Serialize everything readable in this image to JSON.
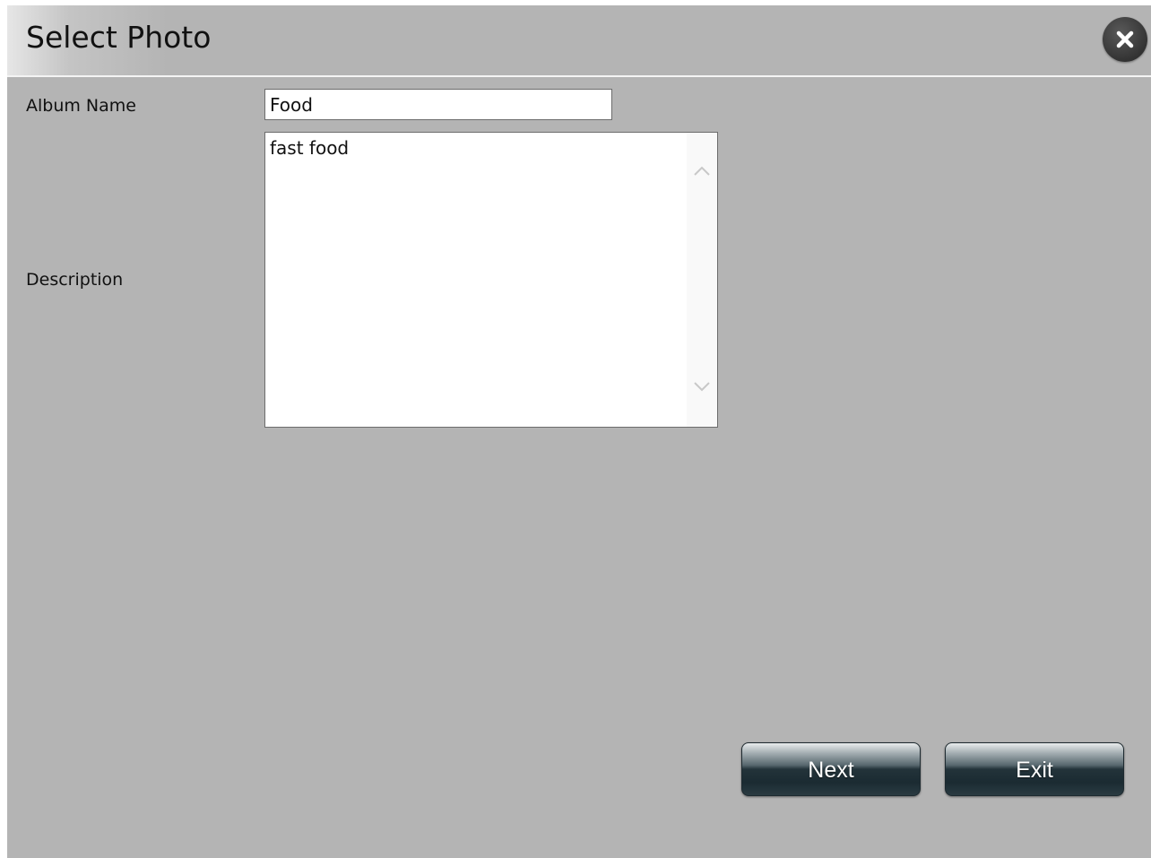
{
  "dialog": {
    "title": "Select Photo"
  },
  "form": {
    "album_name_label": "Album Name",
    "album_name_value": "Food",
    "description_label": "Description",
    "description_value": "fast food"
  },
  "buttons": {
    "next_label": "Next",
    "exit_label": "Exit"
  },
  "icons": {
    "close": "close-icon",
    "scroll_up": "chevron-up-icon",
    "scroll_down": "chevron-down-icon"
  },
  "colors": {
    "dialog_background": "#b4b4b4",
    "button_dark": "#23333a"
  }
}
